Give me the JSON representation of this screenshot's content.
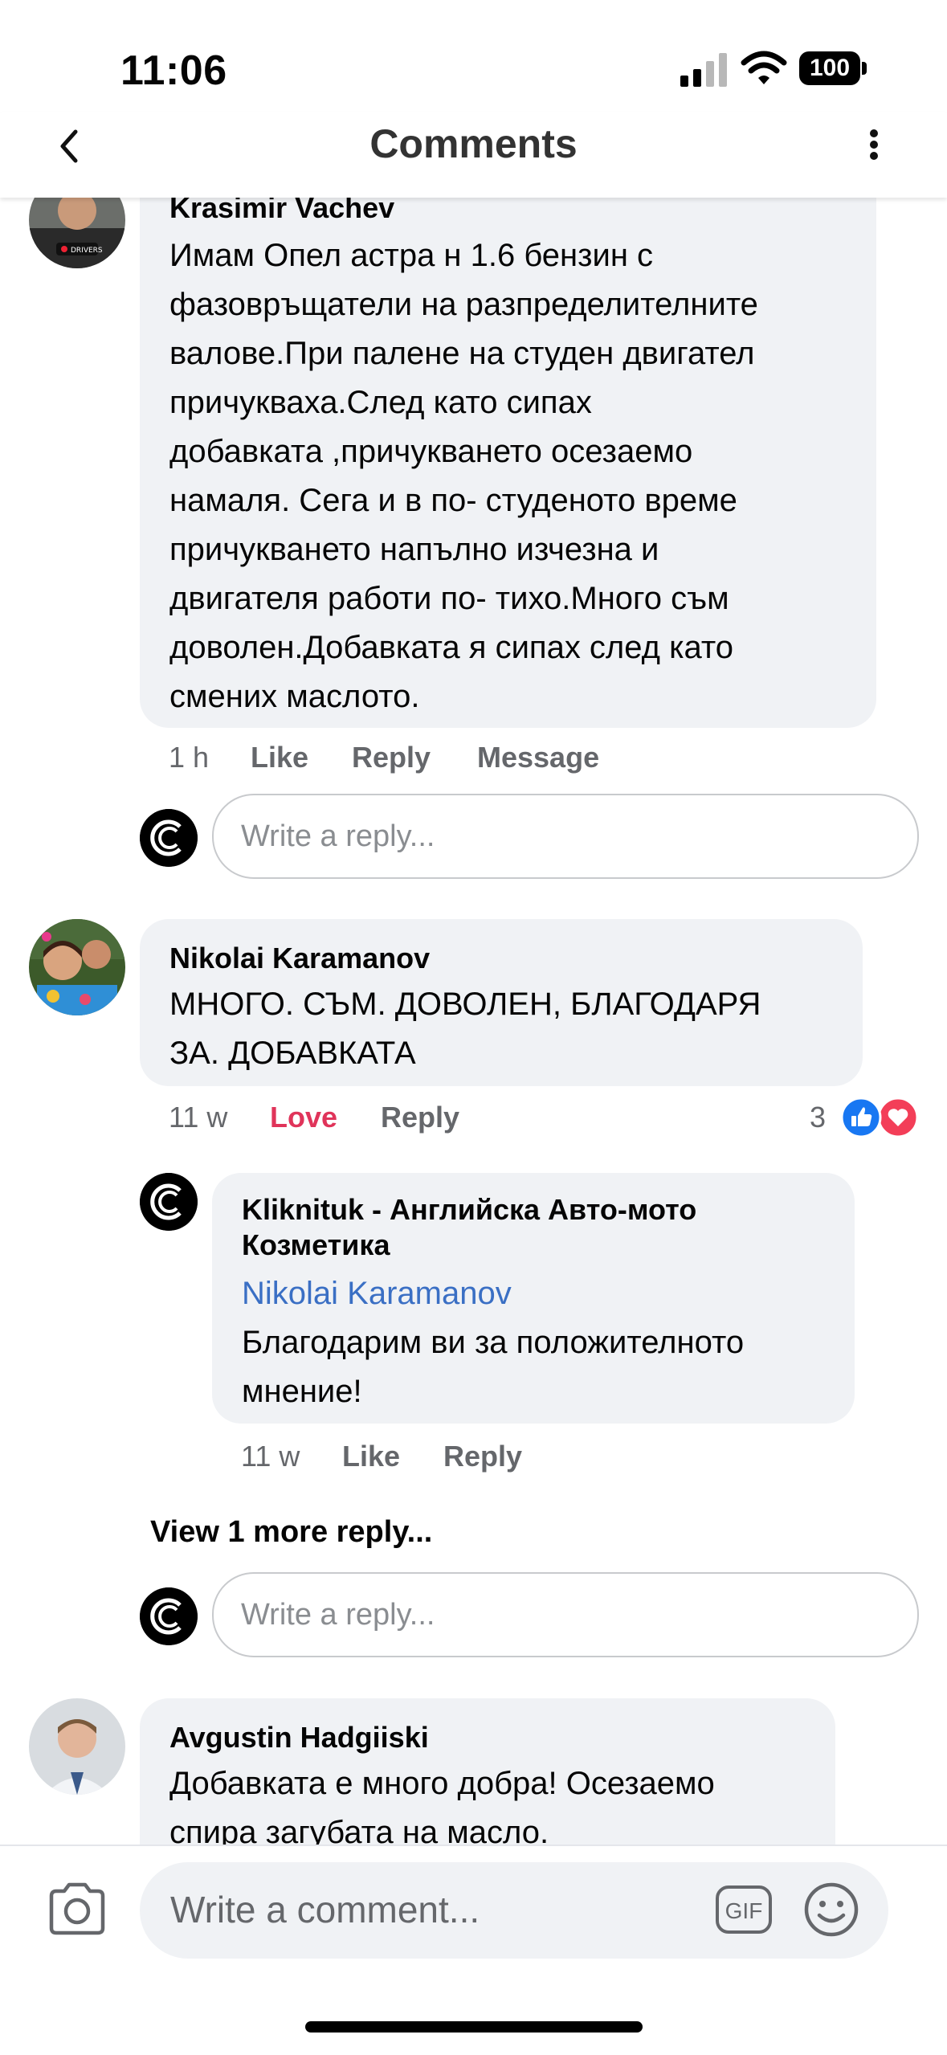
{
  "status_bar": {
    "time": "11:06",
    "battery": "100"
  },
  "header": {
    "title": "Comments"
  },
  "comments": [
    {
      "author": "Krasimir Vachev",
      "text": "Имам Опел астра н 1.6 бензин с фазовръщатели на разпределителните валове.При палене на студен двигател причукваха.След като сипах добавката ,причукването осезаемо намаля. Сега и в по- студеното време причукването напълно изчезна и двигателя работи по- тихо.Много съм доволен.Добавката я сипах след като смених маслото.",
      "lines": [
        "Имам Опел астра н 1.6 бензин с",
        "фазовръщатели на разпределителните",
        "валове.При палене на студен двигател",
        "причукваха.След като сипах",
        "добавката ,причукването осезаемо",
        "намаля. Сега и в по- студеното време",
        "причукването напълно изчезна и",
        "двигателя работи по- тихо.Много съм",
        "доволен.Добавката я сипах след като",
        "смених маслото."
      ],
      "time": "1 h",
      "actions": {
        "like": "Like",
        "reply": "Reply",
        "message": "Message"
      },
      "avatar_badge": "DRIVERS",
      "reply_placeholder": "Write a reply..."
    },
    {
      "author": "Nikolai Karamanov",
      "lines": [
        "МНОГО. СЪМ. ДОВОЛЕН, БЛАГОДАРЯ",
        "ЗА. ДОБАВКАТА"
      ],
      "time": "11 w",
      "actions": {
        "love": "Love",
        "reply": "Reply"
      },
      "reactions_count": "3",
      "reply": {
        "author_lines": [
          "Kliknituk - Английска Авто-мото",
          "Козметика"
        ],
        "mention": "Nikolai Karamanov",
        "lines": [
          "Благодарим ви за положителното",
          "мнение!"
        ],
        "time": "11 w",
        "actions": {
          "like": "Like",
          "reply": "Reply"
        }
      },
      "view_more": "View 1 more reply...",
      "reply_placeholder": "Write a reply..."
    },
    {
      "author": "Avgustin Hadgiiski",
      "lines": [
        "Добавката е много добра! Осезаемо",
        "спира загубата на масло."
      ]
    }
  ],
  "composer": {
    "placeholder": "Write a comment...",
    "gif_label": "GIF"
  },
  "colors": {
    "bubble": "#f0f2f5",
    "love": "#e0345a",
    "mention": "#3a6fc4",
    "like_blue": "#1877f2",
    "heart_red": "#f33e58"
  },
  "icons": [
    "back-icon",
    "more-icon",
    "camera-icon",
    "gif-icon",
    "emoji-icon",
    "like-reaction-icon",
    "love-reaction-icon"
  ]
}
